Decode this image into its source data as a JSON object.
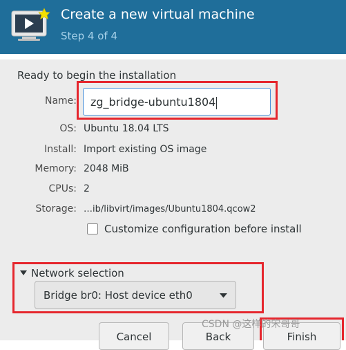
{
  "dialog": {
    "title": "Create a new virtual machine",
    "step": "Step 4 of 4",
    "icon": "virtual-machine-monitor-icon"
  },
  "summary": {
    "ready_text": "Ready to begin the installation",
    "name_label": "Name:",
    "name_value": "zg_bridge-ubuntu1804",
    "os_label": "OS:",
    "os_value": "Ubuntu 18.04 LTS",
    "install_label": "Install:",
    "install_value": "Import existing OS image",
    "memory_label": "Memory:",
    "memory_value": "2048 MiB",
    "cpus_label": "CPUs:",
    "cpus_value": "2",
    "storage_label": "Storage:",
    "storage_value": "…ib/libvirt/images/Ubuntu1804.qcow2",
    "customize_label": "Customize configuration before install",
    "customize_checked": false
  },
  "network": {
    "expander_label": "Network selection",
    "selected": "Bridge br0: Host device eth0"
  },
  "buttons": {
    "cancel": "Cancel",
    "back": "Back",
    "finish": "Finish"
  },
  "watermark": "CSDN @这样的宋哥哥",
  "colors": {
    "header_bg": "#1f6e9a",
    "step_text": "#a7d2ea",
    "highlight": "#e5262d",
    "input_focus": "#4a90d9"
  }
}
